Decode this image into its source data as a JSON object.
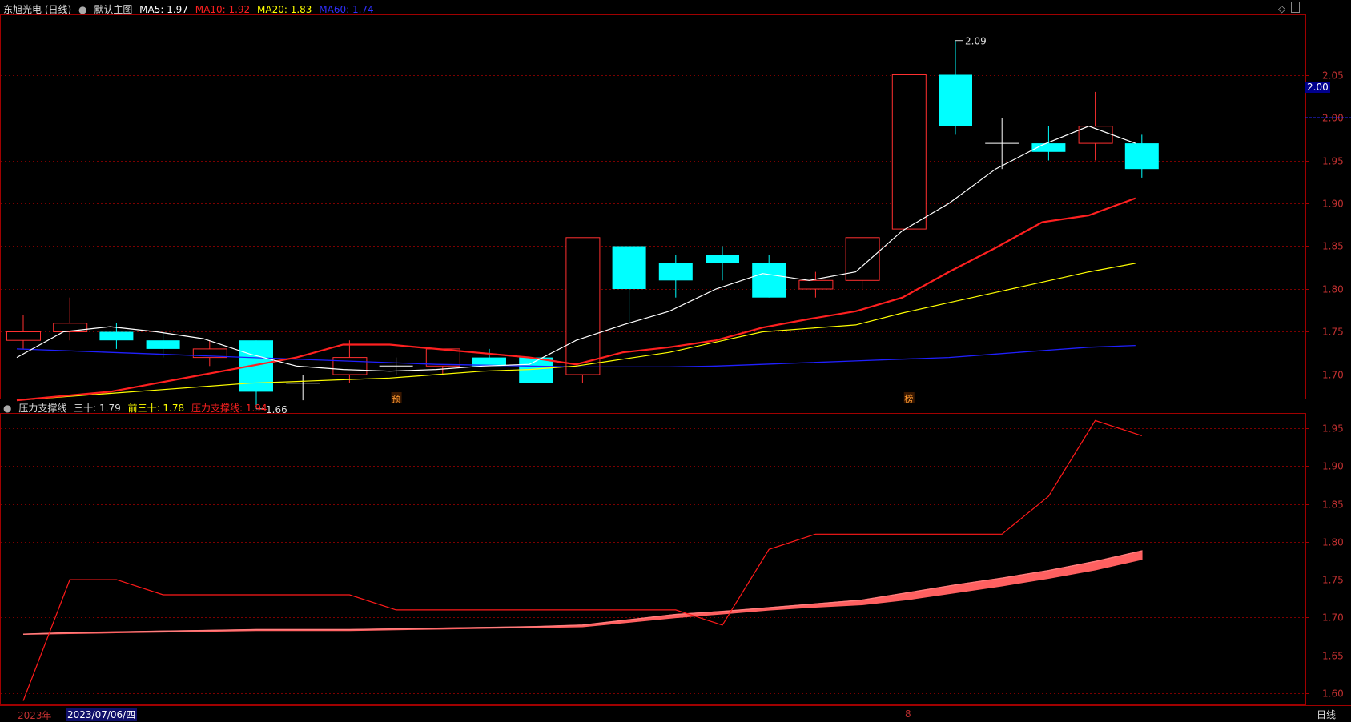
{
  "colors": {
    "bg": "#000000",
    "grid": "#7a0000",
    "border": "#a00000",
    "up": "#ff3030",
    "down": "#00ffff",
    "ma5": "#ffffff",
    "ma10": "#ff2020",
    "ma20": "#ffff00",
    "ma60": "#2020ff",
    "axis_text": "#c03030",
    "line_red": "#ff1a1a",
    "band": "#ff6060"
  },
  "header": {
    "stock": "东旭光电 (日线)",
    "main_chart": "默认主图",
    "ma5": "MA5: 1.97",
    "ma10": "MA10: 1.92",
    "ma20": "MA20: 1.83",
    "ma60": "MA60: 1.74"
  },
  "subheader": {
    "indicator": "压力支撑线",
    "s30": "三十: 1.79",
    "prev30": "前三十: 1.78",
    "pressure": "压力支撑线: 1.94"
  },
  "price_marker": "2.00",
  "bottom": {
    "year": "2023年",
    "date": "2023/07/06/四",
    "mid_mark": "8",
    "period": "日线"
  },
  "chart_data": [
    {
      "type": "candlestick",
      "yticks": [
        1.7,
        1.75,
        1.8,
        1.85,
        1.9,
        1.95,
        2.0,
        2.05
      ],
      "ylim": [
        1.65,
        2.1
      ],
      "candles": [
        {
          "o": 1.74,
          "h": 1.77,
          "l": 1.73,
          "c": 1.75
        },
        {
          "o": 1.75,
          "h": 1.79,
          "l": 1.74,
          "c": 1.76
        },
        {
          "o": 1.75,
          "h": 1.76,
          "l": 1.73,
          "c": 1.74
        },
        {
          "o": 1.74,
          "h": 1.75,
          "l": 1.72,
          "c": 1.73
        },
        {
          "o": 1.72,
          "h": 1.74,
          "l": 1.71,
          "c": 1.73
        },
        {
          "o": 1.74,
          "h": 1.74,
          "l": 1.66,
          "c": 1.68
        },
        {
          "o": 1.69,
          "h": 1.7,
          "l": 1.67,
          "c": 1.69
        },
        {
          "o": 1.7,
          "h": 1.74,
          "l": 1.69,
          "c": 1.72
        },
        {
          "o": 1.71,
          "h": 1.72,
          "l": 1.7,
          "c": 1.71
        },
        {
          "o": 1.71,
          "h": 1.73,
          "l": 1.7,
          "c": 1.73
        },
        {
          "o": 1.72,
          "h": 1.73,
          "l": 1.71,
          "c": 1.71
        },
        {
          "o": 1.72,
          "h": 1.72,
          "l": 1.69,
          "c": 1.69
        },
        {
          "o": 1.7,
          "h": 1.86,
          "l": 1.69,
          "c": 1.86
        },
        {
          "o": 1.85,
          "h": 1.85,
          "l": 1.76,
          "c": 1.8
        },
        {
          "o": 1.83,
          "h": 1.84,
          "l": 1.79,
          "c": 1.81
        },
        {
          "o": 1.84,
          "h": 1.85,
          "l": 1.81,
          "c": 1.83
        },
        {
          "o": 1.83,
          "h": 1.84,
          "l": 1.79,
          "c": 1.79
        },
        {
          "o": 1.8,
          "h": 1.82,
          "l": 1.79,
          "c": 1.81
        },
        {
          "o": 1.81,
          "h": 1.86,
          "l": 1.8,
          "c": 1.86
        },
        {
          "o": 1.87,
          "h": 2.05,
          "l": 1.87,
          "c": 2.05
        },
        {
          "o": 2.05,
          "h": 2.09,
          "l": 1.98,
          "c": 1.99
        },
        {
          "o": 1.97,
          "h": 2.0,
          "l": 1.94,
          "c": 1.97
        },
        {
          "o": 1.97,
          "h": 1.99,
          "l": 1.95,
          "c": 1.96
        },
        {
          "o": 1.97,
          "h": 2.03,
          "l": 1.95,
          "c": 1.99
        },
        {
          "o": 1.97,
          "h": 1.98,
          "l": 1.93,
          "c": 1.94
        }
      ],
      "ma5": [
        1.72,
        1.75,
        1.756,
        1.75,
        1.742,
        1.724,
        1.71,
        1.706,
        1.704,
        1.706,
        1.71,
        1.712,
        1.74,
        1.758,
        1.774,
        1.8,
        1.818,
        1.81,
        1.82,
        1.868,
        1.9,
        1.94,
        1.968,
        1.99,
        1.97
      ],
      "ma10": [
        1.67,
        1.675,
        1.68,
        1.69,
        1.7,
        1.71,
        1.72,
        1.735,
        1.735,
        1.73,
        1.725,
        1.72,
        1.712,
        1.726,
        1.732,
        1.74,
        1.755,
        1.765,
        1.774,
        1.79,
        1.82,
        1.848,
        1.878,
        1.886,
        1.906,
        1.918
      ],
      "ma20": [
        1.67,
        1.674,
        1.678,
        1.682,
        1.686,
        1.69,
        1.692,
        1.694,
        1.696,
        1.7,
        1.704,
        1.706,
        1.71,
        1.718,
        1.726,
        1.738,
        1.75,
        1.754,
        1.758,
        1.772,
        1.784,
        1.796,
        1.808,
        1.82,
        1.83
      ],
      "ma60": [
        1.73,
        1.728,
        1.726,
        1.724,
        1.722,
        1.72,
        1.718,
        1.716,
        1.714,
        1.712,
        1.711,
        1.71,
        1.709,
        1.709,
        1.709,
        1.71,
        1.712,
        1.714,
        1.716,
        1.718,
        1.72,
        1.724,
        1.728,
        1.732,
        1.734,
        1.738
      ],
      "annotations": [
        {
          "label": "2.09",
          "index": 20,
          "price": 2.09
        },
        {
          "label": "1.66",
          "index": 5,
          "price": 1.66
        }
      ],
      "markers": [
        {
          "label": "预",
          "index": 8
        },
        {
          "label": "榜",
          "index": 19
        }
      ]
    },
    {
      "type": "line",
      "yticks": [
        1.6,
        1.65,
        1.7,
        1.75,
        1.8,
        1.85,
        1.9,
        1.95
      ],
      "ylim": [
        1.59,
        1.97
      ],
      "series": [
        {
          "name": "压力支撑线",
          "values": [
            1.59,
            1.75,
            1.75,
            1.73,
            1.73,
            1.73,
            1.73,
            1.73,
            1.71,
            1.71,
            1.71,
            1.71,
            1.71,
            1.71,
            1.71,
            1.69,
            1.79,
            1.81,
            1.81,
            1.81,
            1.81,
            1.81,
            1.86,
            1.96,
            1.94
          ]
        },
        {
          "name": "三十",
          "values": [
            1.678,
            1.68,
            1.681,
            1.682,
            1.683,
            1.684,
            1.684,
            1.684,
            1.685,
            1.686,
            1.687,
            1.688,
            1.69,
            1.697,
            1.704,
            1.708,
            1.713,
            1.718,
            1.723,
            1.733,
            1.743,
            1.752,
            1.762,
            1.774,
            1.788
          ]
        },
        {
          "name": "前三十",
          "values": [
            1.678,
            1.679,
            1.68,
            1.681,
            1.682,
            1.683,
            1.683,
            1.683,
            1.684,
            1.685,
            1.686,
            1.687,
            1.688,
            1.694,
            1.7,
            1.705,
            1.71,
            1.714,
            1.717,
            1.724,
            1.733,
            1.742,
            1.752,
            1.763,
            1.777
          ]
        }
      ]
    }
  ]
}
